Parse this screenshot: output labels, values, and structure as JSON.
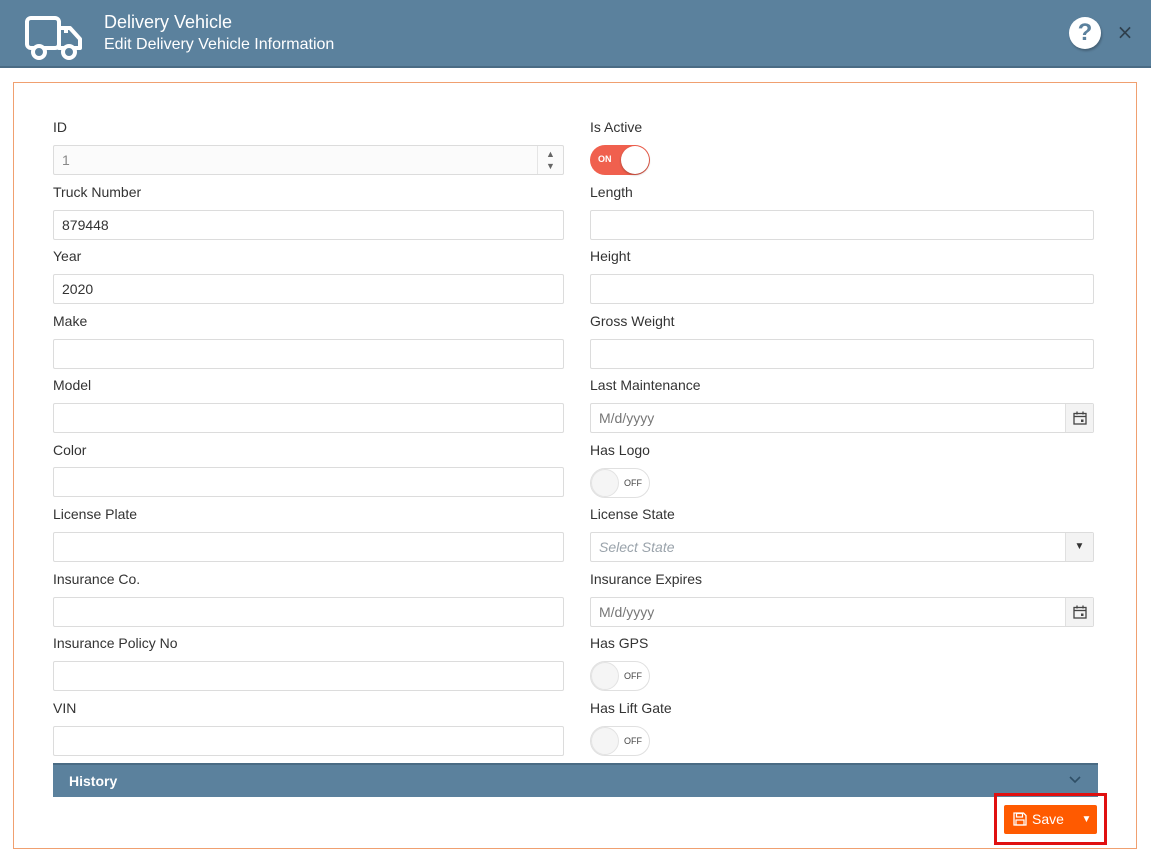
{
  "header": {
    "title": "Delivery Vehicle",
    "subtitle": "Edit Delivery Vehicle Information",
    "help_glyph": "?",
    "close_glyph": "×",
    "icons": [
      "truck-icon",
      "help-icon",
      "close-icon"
    ]
  },
  "form": {
    "id": {
      "label": "ID",
      "value": "1"
    },
    "is_active": {
      "label": "Is Active",
      "state": "ON"
    },
    "truck_number": {
      "label": "Truck Number",
      "value": "879448"
    },
    "length": {
      "label": "Length",
      "value": ""
    },
    "year": {
      "label": "Year",
      "value": "2020"
    },
    "height": {
      "label": "Height",
      "value": ""
    },
    "make": {
      "label": "Make",
      "value": ""
    },
    "gross_weight": {
      "label": "Gross Weight",
      "value": ""
    },
    "model": {
      "label": "Model",
      "value": ""
    },
    "last_maintenance": {
      "label": "Last Maintenance",
      "placeholder": "M/d/yyyy"
    },
    "color": {
      "label": "Color",
      "value": ""
    },
    "has_logo": {
      "label": "Has Logo",
      "state": "OFF"
    },
    "license_plate": {
      "label": "License Plate",
      "value": ""
    },
    "license_state": {
      "label": "License State",
      "placeholder": "Select State"
    },
    "insurance_co": {
      "label": "Insurance Co.",
      "value": ""
    },
    "insurance_expires": {
      "label": "Insurance Expires",
      "placeholder": "M/d/yyyy"
    },
    "insurance_policy_no": {
      "label": "Insurance Policy No",
      "value": ""
    },
    "has_gps": {
      "label": "Has GPS",
      "state": "OFF"
    },
    "vin": {
      "label": "VIN",
      "value": ""
    },
    "has_lift_gate": {
      "label": "Has Lift Gate",
      "state": "OFF"
    }
  },
  "history": {
    "label": "History"
  },
  "actions": {
    "save_label": "Save"
  },
  "colors": {
    "header_bg": "#5b819d",
    "toggle_on": "#f0604e",
    "save_button": "#ff5a00",
    "highlight": "#e01010",
    "panel_border": "#f0a070"
  }
}
